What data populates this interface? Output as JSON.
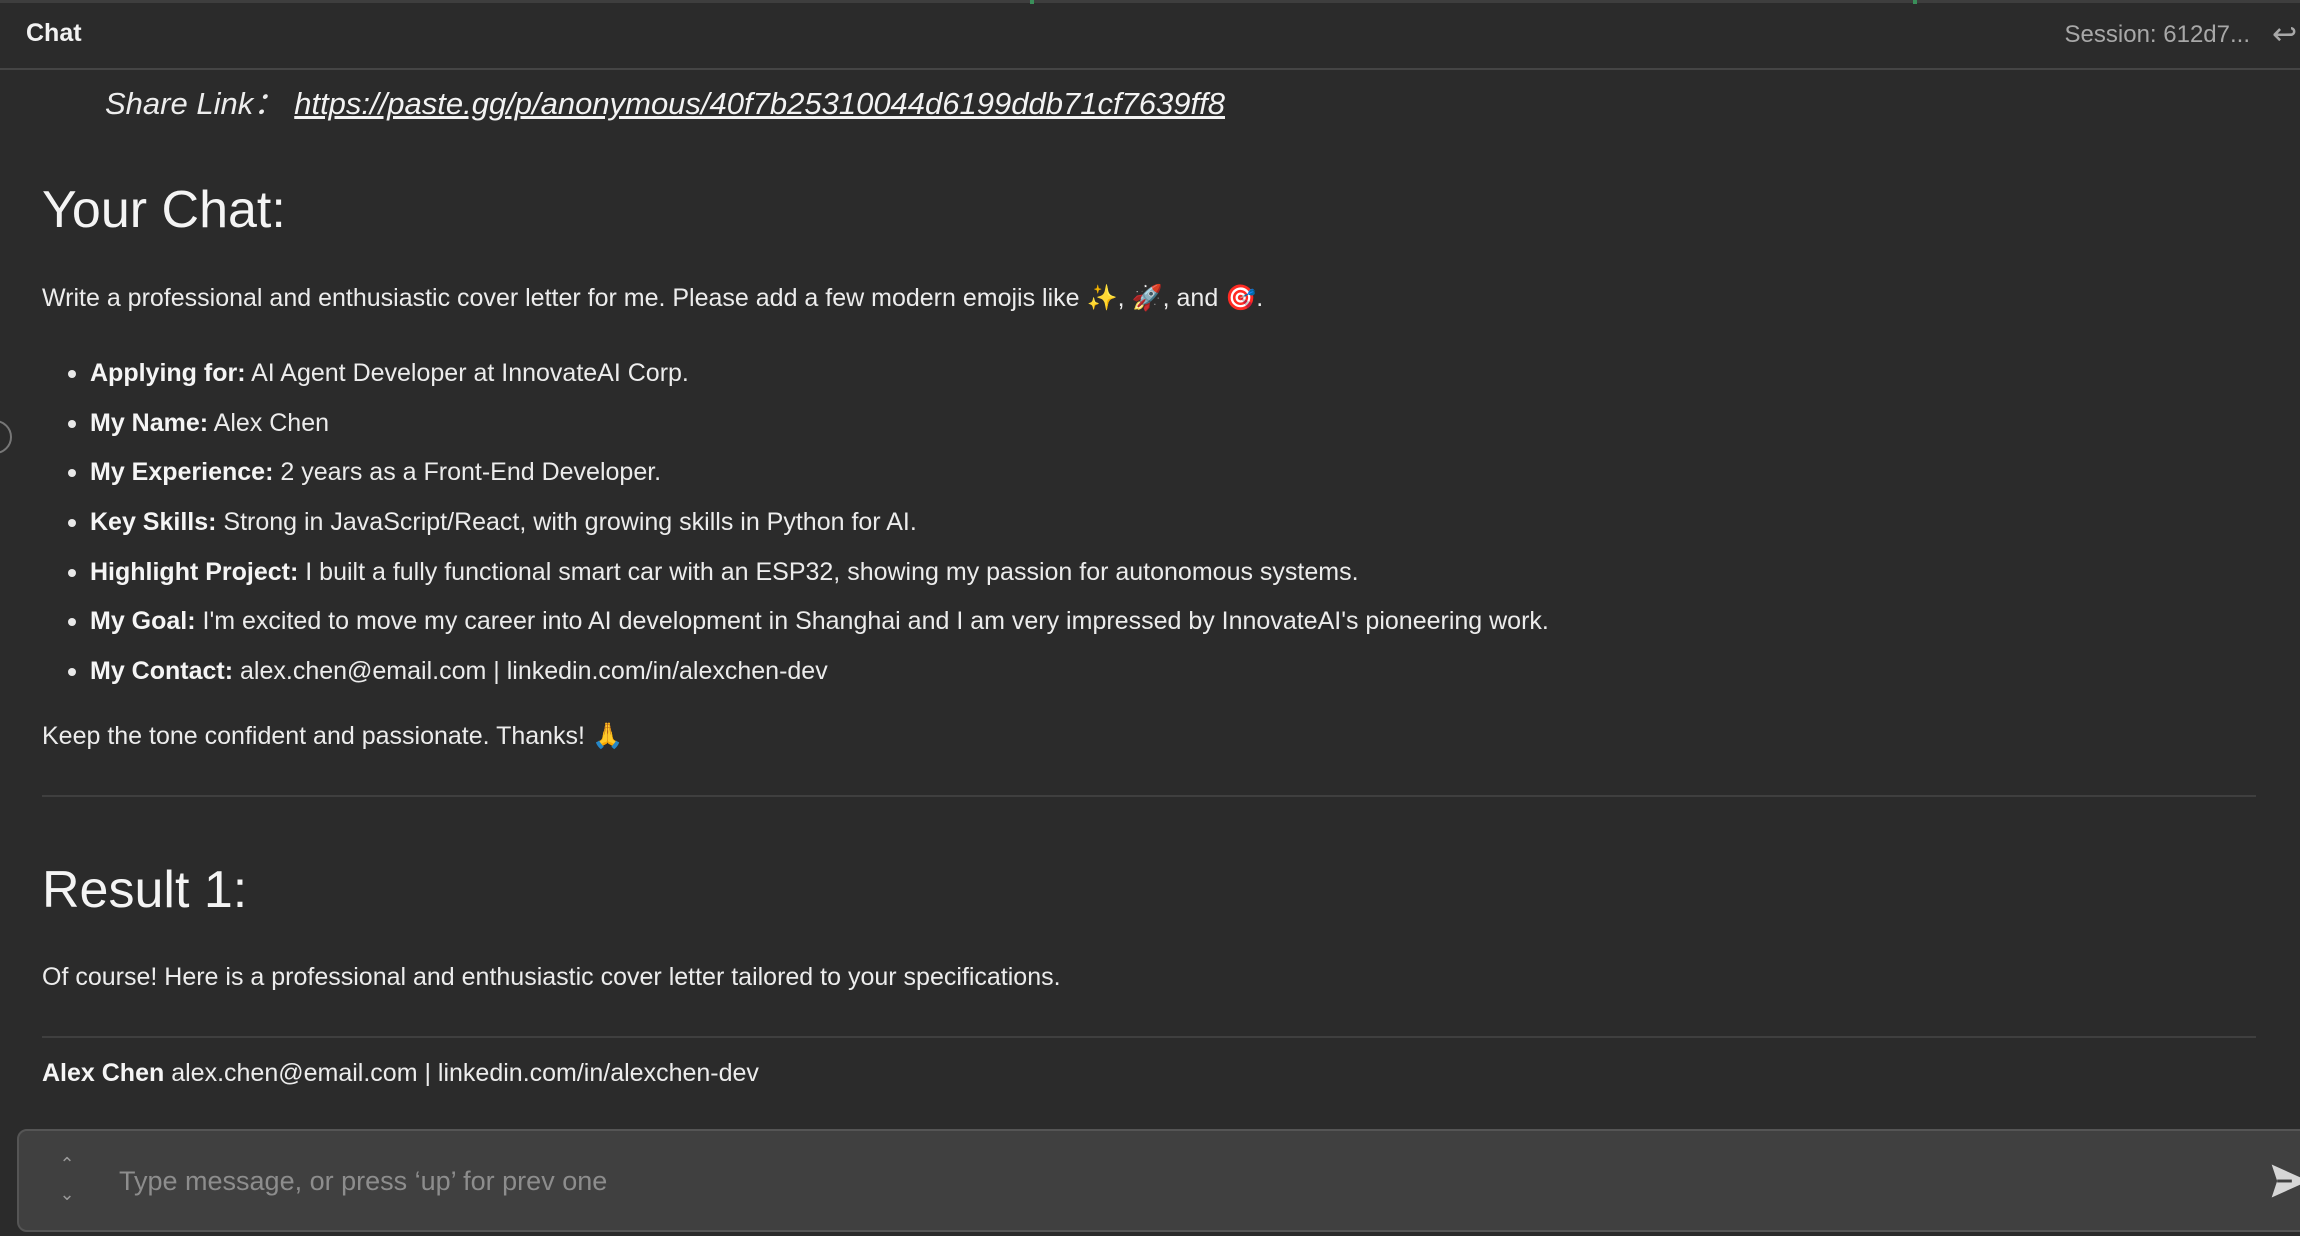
{
  "header": {
    "title": "Chat",
    "session": "Session: 612d7..."
  },
  "share": {
    "label": "Share Link：",
    "url": "https://paste.gg/p/anonymous/40f7b25310044d6199ddb71cf7639ff8"
  },
  "your_chat": {
    "heading": "Your Chat:",
    "prompt": "Write a professional and enthusiastic cover letter for me. Please add a few modern emojis like ✨, 🚀, and 🎯.",
    "bullets": [
      {
        "key": "Applying for:",
        "value": " AI Agent Developer at InnovateAI Corp."
      },
      {
        "key": "My Name:",
        "value": " Alex Chen"
      },
      {
        "key": "My Experience:",
        "value": " 2 years as a Front-End Developer."
      },
      {
        "key": "Key Skills:",
        "value": " Strong in JavaScript/React, with growing skills in Python for AI."
      },
      {
        "key": "Highlight Project:",
        "value": " I built a fully functional smart car with an ESP32, showing my passion for autonomous systems."
      },
      {
        "key": "My Goal:",
        "value": " I'm excited to move my career into AI development in Shanghai and I am very impressed by InnovateAI's pioneering work."
      },
      {
        "key": "My Contact:",
        "value": " alex.chen@email.com | linkedin.com/in/alexchen-dev"
      }
    ],
    "closing": "Keep the tone confident and passionate. Thanks! 🙏"
  },
  "result": {
    "heading": "Result 1:",
    "intro": "Of course! Here is a professional and enthusiastic cover letter tailored to your specifications.",
    "contact_name": "Alex Chen",
    "contact_details": " alex.chen@email.com | linkedin.com/in/alexchen-dev"
  },
  "input": {
    "placeholder": "Type message, or press ‘up’ for prev one"
  },
  "icons": {
    "back": "back-arrow-icon",
    "send": "send-icon",
    "history": "chevron-up-down-icon"
  }
}
